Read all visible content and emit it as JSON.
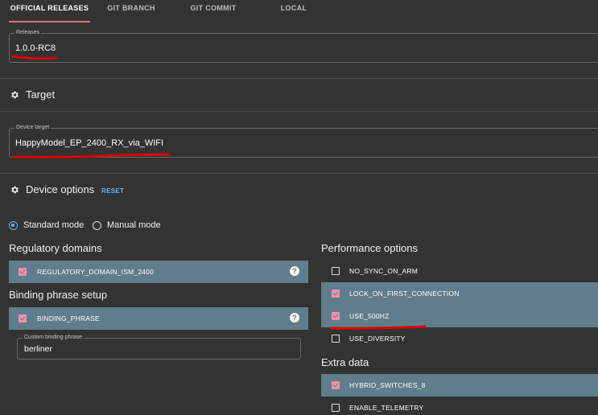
{
  "tabs": [
    {
      "label": "OFFICIAL RELEASES",
      "active": true
    },
    {
      "label": "GIT BRANCH",
      "active": false
    },
    {
      "label": "GIT COMMIT",
      "active": false
    },
    {
      "label": "LOCAL",
      "active": false
    }
  ],
  "releases": {
    "label": "Releases",
    "value": "1.0.0-RC8"
  },
  "target": {
    "title": "Target",
    "icon": "gear-icon"
  },
  "device_target": {
    "label": "Device target",
    "value": "HappyModel_EP_2400_RX_via_WIFI"
  },
  "device_options": {
    "title": "Device options",
    "reset_label": "RESET",
    "icon": "gear-icon"
  },
  "modes": {
    "standard": "Standard mode",
    "manual": "Manual mode",
    "selected": "standard"
  },
  "regulatory": {
    "title": "Regulatory domains",
    "items": [
      {
        "label": "REGULATORY_DOMAIN_ISM_2400",
        "checked": true,
        "help": "?"
      }
    ]
  },
  "binding": {
    "title": "Binding phrase setup",
    "items": [
      {
        "label": "BINDING_PHRASE",
        "checked": true,
        "help": "?"
      }
    ],
    "phrase_label": "Custom binding phrase",
    "phrase_value": "berliner"
  },
  "performance": {
    "title": "Performance options",
    "items": [
      {
        "label": "NO_SYNC_ON_ARM",
        "checked": false
      },
      {
        "label": "LOCK_ON_FIRST_CONNECTION",
        "checked": true
      },
      {
        "label": "USE_500HZ",
        "checked": true
      },
      {
        "label": "USE_DIVERSITY",
        "checked": false
      }
    ]
  },
  "extra": {
    "title": "Extra data",
    "items": [
      {
        "label": "HYBRID_SWITCHES_8",
        "checked": true
      },
      {
        "label": "ENABLE_TELEMETRY",
        "checked": false
      }
    ]
  },
  "colors": {
    "accent": "#64b5f6",
    "checkbox_on": "#f48fb1",
    "selected_row": "#607d8b",
    "annotation": "#e00000"
  }
}
